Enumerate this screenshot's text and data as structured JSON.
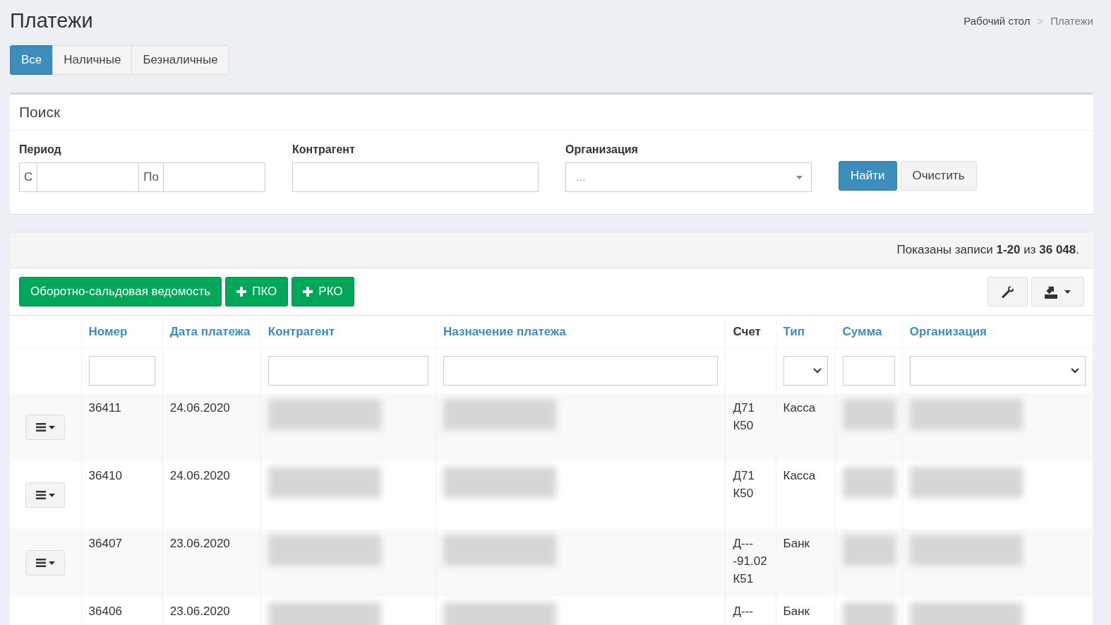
{
  "page_title": "Платежи",
  "breadcrumb": [
    {
      "label": "Рабочий стол",
      "kind": "link"
    },
    {
      "label": ">",
      "kind": "separator"
    },
    {
      "label": "Платежи",
      "kind": "current"
    }
  ],
  "tabs": [
    {
      "label": "Все",
      "selected": true
    },
    {
      "label": "Наличные",
      "selected": false
    },
    {
      "label": "Безналичные",
      "selected": false
    }
  ],
  "search": {
    "title": "Поиск",
    "fields": [
      {
        "kind": "range",
        "label": "Период",
        "from_addon": "С",
        "to_addon": "По"
      },
      {
        "kind": "text",
        "label": "Контрагент"
      },
      {
        "kind": "select",
        "label": "Организация",
        "value": "..."
      }
    ],
    "buttons": [
      {
        "label": "Найти",
        "kind": "primary"
      },
      {
        "label": "Очистить",
        "kind": "default"
      }
    ]
  },
  "results": {
    "summary": "Показаны записи **1-20** из **36 048**.",
    "actions": [
      {
        "label": "Оборотно-сальдовая ведомость",
        "kind": "text"
      },
      {
        "label": "ПКО",
        "kind": "add"
      },
      {
        "label": "РКО",
        "kind": "add"
      }
    ],
    "columns": [
      {
        "kind": "actions"
      },
      {
        "label": "Номер",
        "sortable": true,
        "filter": {
          "kind": "input"
        }
      },
      {
        "label": "Дата платежа",
        "sortable": true
      },
      {
        "label": "Контрагент",
        "sortable": true,
        "filter": {
          "kind": "input"
        }
      },
      {
        "label": "Назначение платежа",
        "sortable": true,
        "filter": {
          "kind": "input"
        }
      },
      {
        "label": "Счет",
        "sortable": false
      },
      {
        "label": "Тип",
        "sortable": true,
        "filter": {
          "kind": "select"
        }
      },
      {
        "label": "Сумма",
        "sortable": true,
        "filter": {
          "kind": "input"
        }
      },
      {
        "label": "Организация",
        "sortable": true,
        "filter": {
          "kind": "select"
        }
      }
    ],
    "rows": [
      {
        "cells": [
          {
            "kind": "menu"
          },
          {
            "kind": "text",
            "text": "36411"
          },
          {
            "kind": "text",
            "text": "24.06.2020"
          },
          {
            "kind": "redacted"
          },
          {
            "kind": "redacted"
          },
          {
            "kind": "text",
            "text": "Д71 К50"
          },
          {
            "kind": "text",
            "text": "Касса"
          },
          {
            "kind": "redacted"
          },
          {
            "kind": "redacted"
          }
        ]
      },
      {
        "cells": [
          {
            "kind": "menu"
          },
          {
            "kind": "text",
            "text": "36410"
          },
          {
            "kind": "text",
            "text": "24.06.2020"
          },
          {
            "kind": "redacted"
          },
          {
            "kind": "redacted"
          },
          {
            "kind": "text",
            "text": "Д71 К50"
          },
          {
            "kind": "text",
            "text": "Касса"
          },
          {
            "kind": "redacted"
          },
          {
            "kind": "redacted"
          }
        ]
      },
      {
        "cells": [
          {
            "kind": "menu"
          },
          {
            "kind": "text",
            "text": "36407"
          },
          {
            "kind": "text",
            "text": "23.06.2020"
          },
          {
            "kind": "redacted"
          },
          {
            "kind": "redacted"
          },
          {
            "kind": "text",
            "text": "Д----91.02 К51"
          },
          {
            "kind": "text",
            "text": "Банк"
          },
          {
            "kind": "redacted"
          },
          {
            "kind": "redacted"
          }
        ]
      },
      {
        "cells": [
          {
            "kind": "empty"
          },
          {
            "kind": "text",
            "text": "36406"
          },
          {
            "kind": "text",
            "text": "23.06.2020"
          },
          {
            "kind": "redacted"
          },
          {
            "kind": "redacted"
          },
          {
            "kind": "text",
            "text": "Д---"
          },
          {
            "kind": "text",
            "text": "Банк"
          },
          {
            "kind": "redacted"
          },
          {
            "kind": "redacted"
          }
        ]
      }
    ]
  }
}
